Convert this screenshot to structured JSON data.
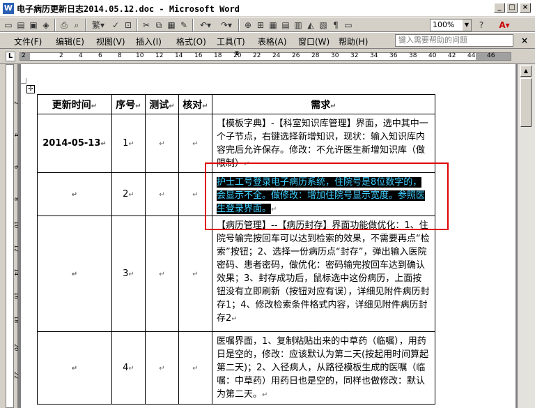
{
  "window": {
    "title": "电子病历更新日志2014.05.12.doc - Microsoft Word",
    "app_icon": "W",
    "buttons": [
      "_",
      "□",
      "×"
    ]
  },
  "toolbar": {
    "zoom": "100%",
    "icons": [
      "new-icon",
      "open-icon",
      "save-icon",
      "permission-icon",
      "print-icon",
      "print-preview-icon",
      "traditional-chinese-icon",
      "spelling-icon",
      "research-icon",
      "cut-icon",
      "copy-icon",
      "paste-icon",
      "format-painter-icon",
      "undo-icon",
      "redo-icon",
      "hyperlink-icon",
      "tables-icon",
      "insert-table-icon",
      "insert-excel-icon",
      "columns-icon",
      "drawing-icon",
      "document-map-icon",
      "show-hide-icon",
      "read-icon",
      "help-icon",
      "font-color-icon"
    ]
  },
  "menu": {
    "items": [
      "文件(F)",
      "编辑(E)",
      "视图(V)",
      "插入(I)",
      "格式(O)",
      "工具(T)",
      "表格(A)",
      "窗口(W)",
      "帮助(H)"
    ],
    "help_placeholder": "键入需要帮助的问题",
    "close": "×"
  },
  "ruler": {
    "ticks": [
      "2",
      "2",
      "4",
      "6",
      "8",
      "10",
      "12",
      "14",
      "16",
      "18",
      "20",
      "22",
      "24",
      "26",
      "28",
      "30",
      "32",
      "34",
      "36",
      "38",
      "40",
      "42",
      "44",
      "46"
    ],
    "tab_selector": "L"
  },
  "vruler": {
    "ticks": [
      "2",
      "4",
      "6",
      "8",
      "10",
      "12",
      "14",
      "16",
      "18",
      "20",
      "22"
    ]
  },
  "table": {
    "headers": [
      "更新时间",
      "序号",
      "测试",
      "核对",
      "需求"
    ],
    "mark": "↵",
    "rows": [
      {
        "date": "2014-05-13",
        "num": "1",
        "req": "【模板字典】-【科室知识库管理】界面，选中其中一个子节点，右键选择新增知识，现状：输入知识库内容完后允许保存。修改：不允许医生新增知识库（做限制）"
      },
      {
        "date": "",
        "num": "2",
        "req": "护士工号登录电子病历系统，住院号是8位数字的，会显示不全。做修改：增加住院号显示宽度。参照医生登录界面。"
      },
      {
        "date": "",
        "num": "3",
        "req": "【病历管理】--【病历封存】界面功能做优化：1、住院号输完按回车可以达到检索的效果，不需要再点“检索”按钮；2、选择一份病历点“封存”，弹出输入医院密码、患者密码，做优化：密码输完按回车达到确认效果；3、封存成功后，鼠标选中这份病历，上面按钮没有立即刷新（按钮对应有误），详细见附件病历封存1；4、修改检索条件格式内容，详细见附件病历封存2"
      },
      {
        "date": "",
        "num": "4",
        "req": "医嘱界面，1、复制粘贴出来的中草药（临嘱），用药日是空的，修改：应该默认为第二天(按起用时间算起第二天)；2、入径病人，从路径模板生成的医嘱（临嘱：中草药）用药日也是空的，同样也做修改：默认为第二天。"
      }
    ]
  },
  "colors": {
    "highlight_bg": "#000000",
    "highlight_text": "#3fd0ff",
    "annotation_box": "#e00000",
    "chrome": "#d4d0c8"
  }
}
